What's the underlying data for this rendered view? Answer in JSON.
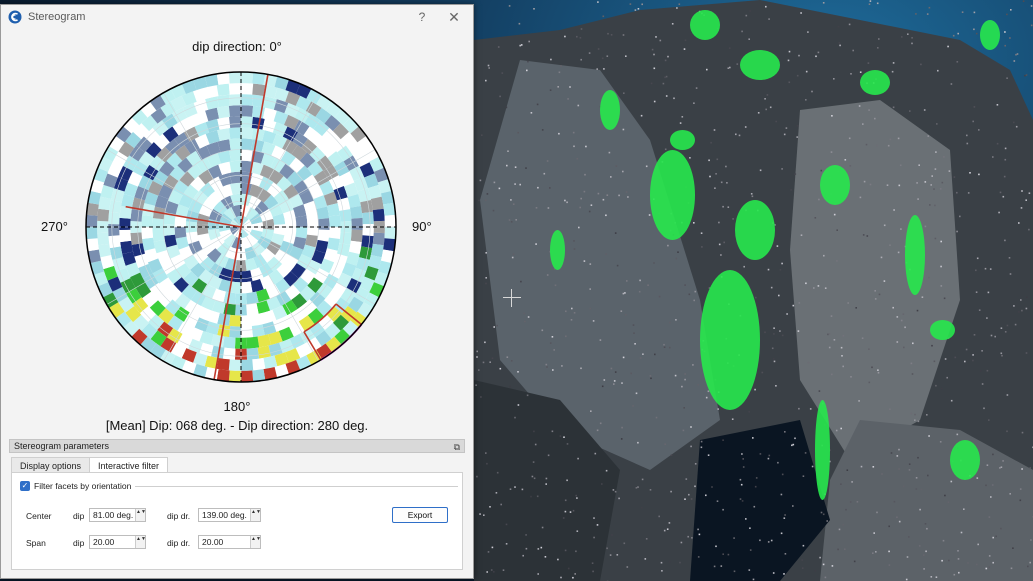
{
  "window": {
    "title": "Stereogram",
    "help_symbol": "?",
    "close_symbol": "✕",
    "app_icon": "cloudcompare-logo-icon"
  },
  "stereogram": {
    "label_north": "dip direction: 0°",
    "label_south": "180°",
    "label_west": "270°",
    "label_east": "90°",
    "mean_text": "[Mean] Dip: 068 deg. - Dip direction: 280 deg.",
    "mean_dip_deg": 68,
    "mean_dip_direction_deg": 280,
    "filter_dip_deg": 81,
    "filter_dip_direction_deg": 139,
    "filter_span_dip_deg": 20,
    "filter_span_dipdir_deg": 20,
    "palette": [
      "#bff1f1",
      "#aee8ee",
      "#c9f3f3",
      "#ffffff",
      "#9ad7e3",
      "#7a8fb0",
      "#1c2f7a",
      "#2e9a3a",
      "#3ccf3c",
      "#9bd84a",
      "#e6e64a",
      "#a0a0a0",
      "#c0392b"
    ],
    "colors": {
      "mean_line": "#c0392b",
      "filter_arc": "#d63ad6",
      "outline": "#000000"
    }
  },
  "params": {
    "header": "Stereogram parameters",
    "float_symbol": "⧉",
    "tabs": [
      {
        "label": "Display options"
      },
      {
        "label": "Interactive filter"
      }
    ],
    "filter_label": "Filter facets by orientation",
    "filter_checked": true,
    "check_symbol": "✓",
    "center_label": "Center",
    "span_label": "Span",
    "dip_label": "dip",
    "dipdir_label": "dip dr.",
    "center_dip_value": "81.00 deg.",
    "center_dipdir_value": "139.00 deg.",
    "span_dip_value": "20.00",
    "span_dipdir_value": "20.00",
    "spin_symbol": "▲▼",
    "export_label": "Export"
  }
}
